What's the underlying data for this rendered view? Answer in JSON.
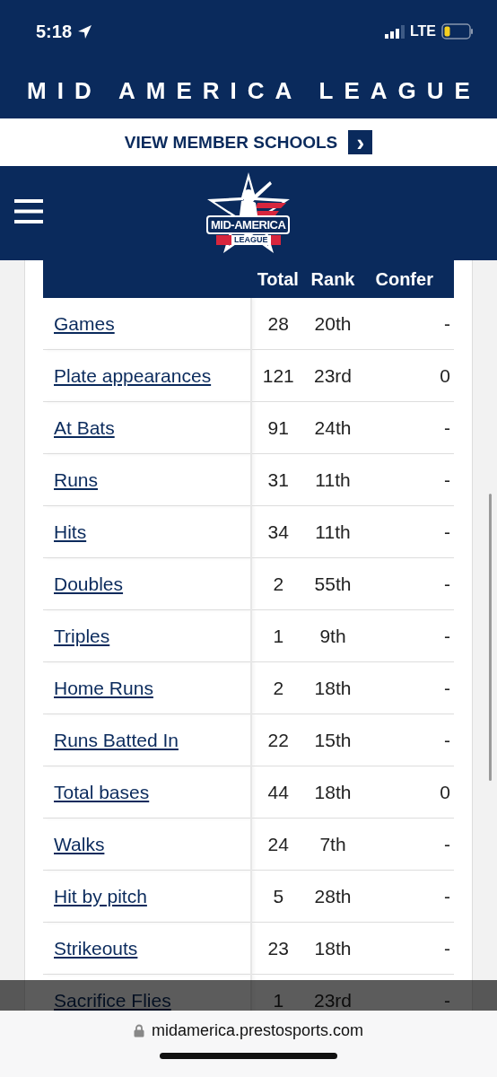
{
  "status_bar": {
    "time": "5:18",
    "network": "LTE"
  },
  "site_title": "MID AMERICA LEAGUE",
  "member_link": {
    "label": "VIEW MEMBER SCHOOLS",
    "arrow": "›"
  },
  "logo": {
    "name": "MID-AMERICA",
    "sub": "LEAGUE"
  },
  "table": {
    "columns": [
      "Total",
      "Rank",
      "Confer"
    ],
    "rows": [
      {
        "name": "Games",
        "total": "28",
        "rank": "20th",
        "conf": "-"
      },
      {
        "name": "Plate appearances",
        "total": "121",
        "rank": "23rd",
        "conf": "0"
      },
      {
        "name": "At Bats",
        "total": "91",
        "rank": "24th",
        "conf": "-"
      },
      {
        "name": "Runs",
        "total": "31",
        "rank": "11th",
        "conf": "-"
      },
      {
        "name": "Hits",
        "total": "34",
        "rank": "11th",
        "conf": "-"
      },
      {
        "name": "Doubles",
        "total": "2",
        "rank": "55th",
        "conf": "-"
      },
      {
        "name": "Triples",
        "total": "1",
        "rank": "9th",
        "conf": "-"
      },
      {
        "name": "Home Runs",
        "total": "2",
        "rank": "18th",
        "conf": "-"
      },
      {
        "name": "Runs Batted In",
        "total": "22",
        "rank": "15th",
        "conf": "-"
      },
      {
        "name": "Total bases",
        "total": "44",
        "rank": "18th",
        "conf": "0"
      },
      {
        "name": "Walks",
        "total": "24",
        "rank": "7th",
        "conf": "-"
      },
      {
        "name": "Hit by pitch",
        "total": "5",
        "rank": "28th",
        "conf": "-"
      },
      {
        "name": "Strikeouts",
        "total": "23",
        "rank": "18th",
        "conf": "-"
      },
      {
        "name": "Sacrifice Flies",
        "total": "1",
        "rank": "23rd",
        "conf": "-"
      }
    ]
  },
  "address_bar": {
    "url": "midamerica.prestosports.com"
  }
}
